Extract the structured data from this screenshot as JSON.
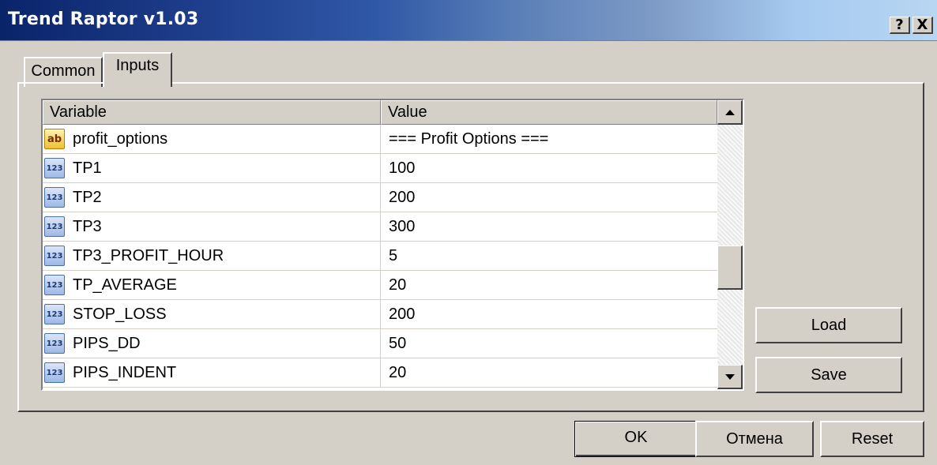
{
  "window": {
    "title": "Trend Raptor v1.03",
    "help_label": "?",
    "close_label": "X"
  },
  "tabs": [
    {
      "label": "Common",
      "active": false
    },
    {
      "label": "Inputs",
      "active": true
    }
  ],
  "grid": {
    "headers": {
      "variable": "Variable",
      "value": "Value"
    },
    "rows": [
      {
        "icon": "string-icon",
        "icon_text": "ab",
        "variable": "profit_options",
        "value": "=== Profit Options ==="
      },
      {
        "icon": "integer-icon",
        "icon_text": "123",
        "variable": "TP1",
        "value": "100"
      },
      {
        "icon": "integer-icon",
        "icon_text": "123",
        "variable": "TP2",
        "value": "200"
      },
      {
        "icon": "integer-icon",
        "icon_text": "123",
        "variable": "TP3",
        "value": "300"
      },
      {
        "icon": "integer-icon",
        "icon_text": "123",
        "variable": "TP3_PROFIT_HOUR",
        "value": "5"
      },
      {
        "icon": "integer-icon",
        "icon_text": "123",
        "variable": "TP_AVERAGE",
        "value": "20"
      },
      {
        "icon": "integer-icon",
        "icon_text": "123",
        "variable": "STOP_LOSS",
        "value": "200"
      },
      {
        "icon": "integer-icon",
        "icon_text": "123",
        "variable": "PIPS_DD",
        "value": "50"
      },
      {
        "icon": "integer-icon",
        "icon_text": "123",
        "variable": "PIPS_INDENT",
        "value": "20"
      }
    ]
  },
  "side_buttons": {
    "load": "Load",
    "save": "Save"
  },
  "footer_buttons": {
    "ok": "OK",
    "cancel": "Отмена",
    "reset": "Reset"
  }
}
